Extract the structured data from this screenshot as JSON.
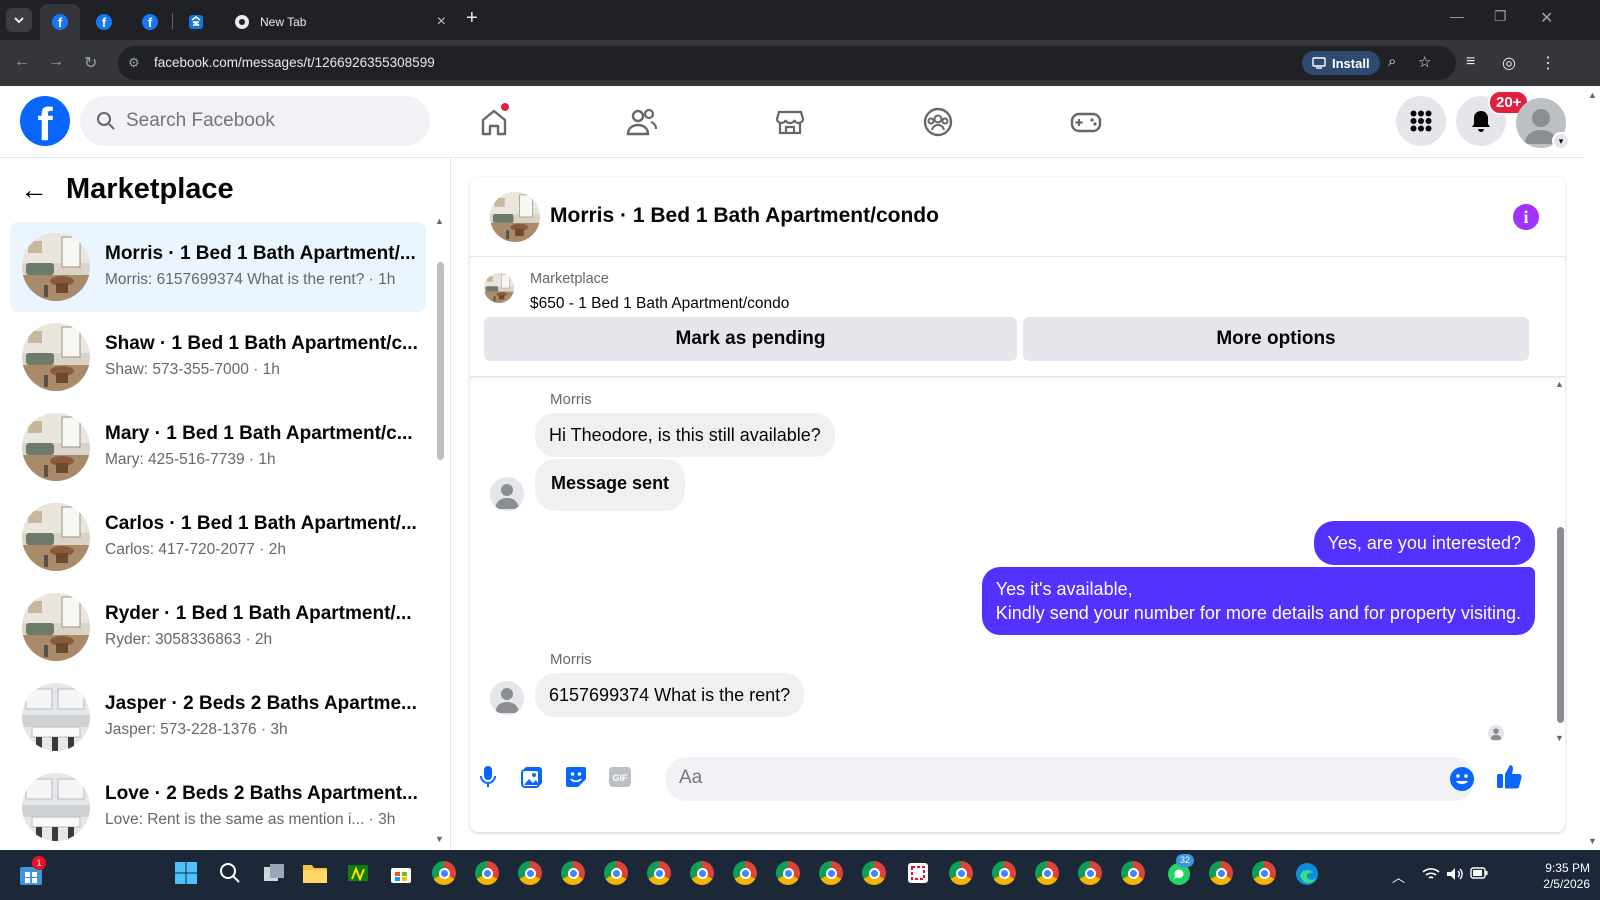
{
  "browser": {
    "tabs": [
      {
        "label": "",
        "icon": "facebook-icon",
        "active": true
      },
      {
        "label": "",
        "icon": "facebook-icon",
        "active": false
      },
      {
        "label": "",
        "icon": "facebook-icon",
        "active": false
      },
      {
        "label": "",
        "icon": "zillow-icon",
        "active": false
      },
      {
        "label": "New Tab",
        "icon": "chrome-icon",
        "active": false
      }
    ],
    "url": "facebook.com/messages/t/1266926355308599",
    "install_label": "Install"
  },
  "fb": {
    "search_placeholder": "Search Facebook",
    "notification_badge": "20+"
  },
  "left": {
    "title": "Marketplace",
    "conversations": [
      {
        "name": "Morris · 1 Bed 1 Bath Apartment/...",
        "preview": "Morris: 6157699374 What is the rent? · 1h",
        "active": true,
        "thumb": "living"
      },
      {
        "name": "Shaw · 1 Bed 1 Bath Apartment/c...",
        "preview": "Shaw: 573-355-7000 · 1h",
        "active": false,
        "thumb": "living"
      },
      {
        "name": "Mary · 1 Bed 1 Bath Apartment/c...",
        "preview": "Mary: 425-516-7739 · 1h",
        "active": false,
        "thumb": "living"
      },
      {
        "name": "Carlos · 1 Bed 1 Bath Apartment/...",
        "preview": "Carlos: 417-720-2077 · 2h",
        "active": false,
        "thumb": "living"
      },
      {
        "name": "Ryder · 1 Bed 1 Bath Apartment/...",
        "preview": "Ryder: 3058336863 · 2h",
        "active": false,
        "thumb": "living"
      },
      {
        "name": "Jasper · 2 Beds 2 Baths Apartme...",
        "preview": "Jasper: 573-228-1376 · 3h",
        "active": false,
        "thumb": "kitchen"
      },
      {
        "name": "Love · 2 Beds 2 Baths Apartment...",
        "preview": "Love: Rent is the same as mention i...  · 3h",
        "active": false,
        "thumb": "kitchen"
      }
    ]
  },
  "chat": {
    "title": "Morris · 1 Bed 1 Bath Apartment/condo",
    "marketplace_label": "Marketplace",
    "listing": "$650 - 1 Bed 1 Bath Apartment/condo",
    "mark_pending_label": "Mark as pending",
    "more_options_label": "More options",
    "sender1": "Morris",
    "msg1": "Hi Theodore, is this still available?",
    "msg2": "Message sent",
    "msg3": "Yes, are you interested?",
    "msg4_line1": "Yes it's available,",
    "msg4_line2": "Kindly send your number for more details and for property visiting.",
    "sender2": "Morris",
    "msg5": "6157699374 What is the rent?",
    "composer_placeholder": "Aa"
  },
  "taskbar": {
    "store_badge": "1",
    "whatsapp_badge": "32",
    "time": "9:35 PM",
    "date": "2/5/2026"
  },
  "colors": {
    "fb_blue": "#0866ff",
    "out_bubble": "#5132fe",
    "info_purple": "#a033ff",
    "active_row": "#ebf5ff"
  }
}
